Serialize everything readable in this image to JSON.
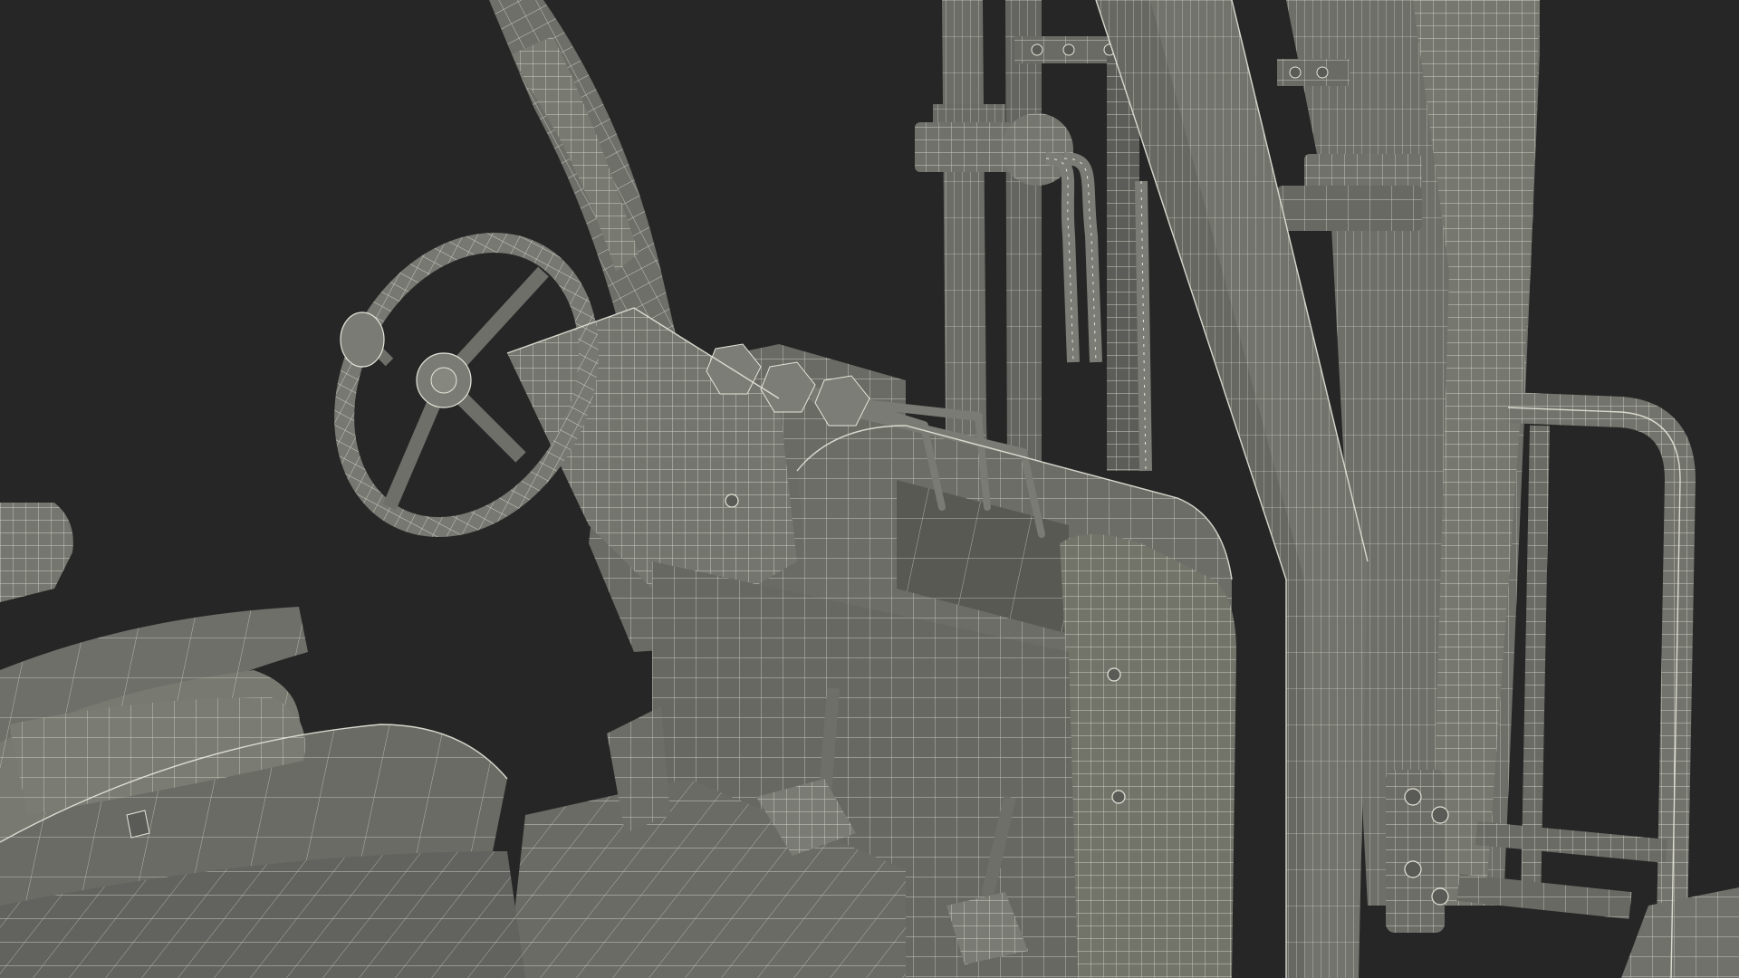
{
  "scene": {
    "background": "#262626",
    "surface_color": "#6e6f69",
    "surface_dark": "#5a5b56",
    "surface_light": "#7a7b74",
    "wire_color": "#e4e3d8",
    "wire_dark": "#2f302c"
  }
}
